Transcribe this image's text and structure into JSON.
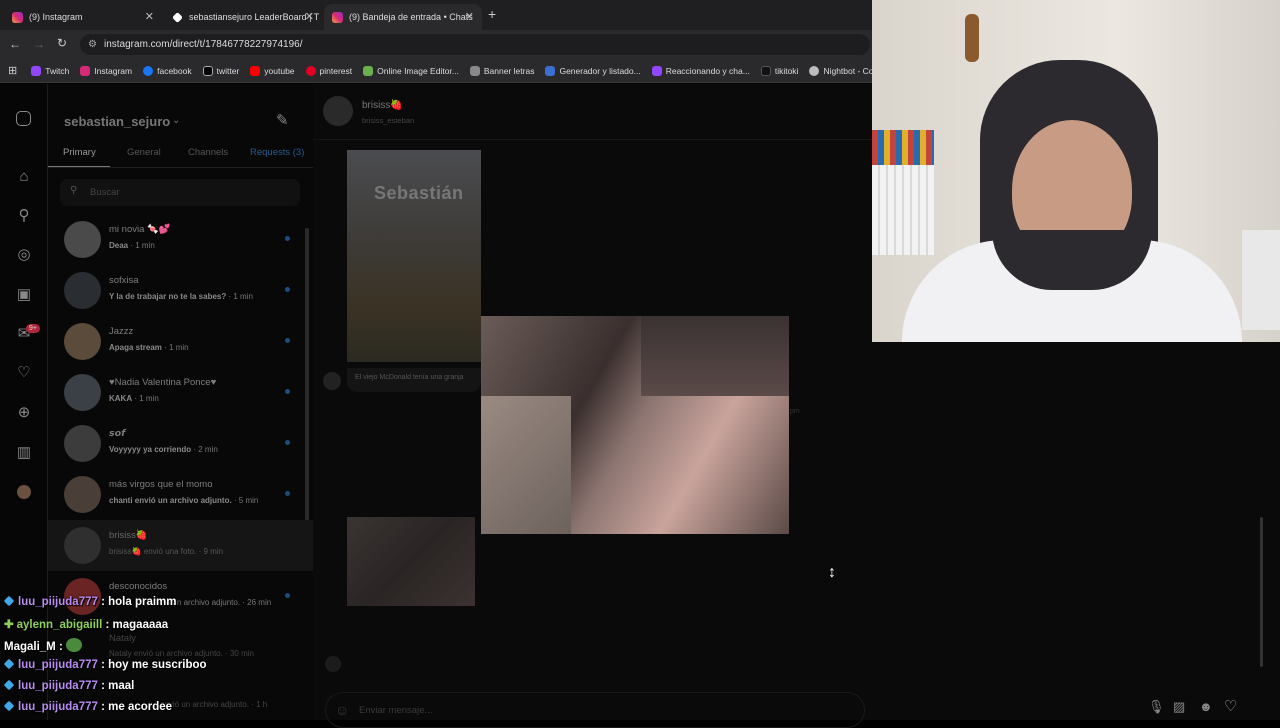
{
  "browser": {
    "tabs": [
      {
        "label": "(9) Instagram"
      },
      {
        "label": "sebastiansejuro LeaderBoard | T"
      },
      {
        "label": "(9) Bandeja de entrada • Chats"
      }
    ],
    "new_tab": "+",
    "url": "instagram.com/direct/t/17846778227974196/",
    "bookmarks": [
      "Twitch",
      "Instagram",
      "facebook",
      "twitter",
      "youtube",
      "pinterest",
      "Online Image Editor...",
      "Banner letras",
      "Generador y listado...",
      "Reaccionando y cha...",
      "tikitoki",
      "Nightbot - Comm"
    ]
  },
  "inbox": {
    "username": "sebastian_sejuro",
    "tabs": {
      "primary": "Primary",
      "general": "General",
      "channels": "Channels",
      "requests": "Requests (3)"
    },
    "search_placeholder": "Buscar",
    "notif_badge": "9+",
    "threads": [
      {
        "name": "mi novia 🍬💕",
        "preview": "Deaa",
        "time": "· 1 min"
      },
      {
        "name": "sofxisa",
        "preview": "Y la de trabajar no te la sabes?",
        "time": "· 1 min"
      },
      {
        "name": "Jazzz",
        "preview": "Apaga stream",
        "time": "· 1 min"
      },
      {
        "name": "♥Nadia Valentina Ponce♥",
        "preview": "KAKA",
        "time": "· 1 min"
      },
      {
        "name": "𝙨𝙤𝙛",
        "preview": "Voyyyyy ya corriendo",
        "time": "· 2 min"
      },
      {
        "name": "más virgos que el momo",
        "preview": "chanti envió un archivo adjunto.",
        "time": "· 5 min"
      },
      {
        "name": "brisiss🍓",
        "preview": "brisiss🍓 envió una foto.",
        "time": "· 9 min"
      },
      {
        "name": "desconocidos",
        "preview": "vió un archivo adjunto.",
        "time": "· 26 min"
      },
      {
        "name": "Nataly",
        "preview": "Nataly envió un archivo adjunto.",
        "time": "· 30 min"
      },
      {
        "name": "",
        "preview": "envió un archivo adjunto.",
        "time": "· 1 h"
      }
    ]
  },
  "conversation": {
    "name": "brisiss🍓",
    "handle": "brisiss_esteban",
    "image_caption_overlay": "Sebastián",
    "message_text": "El viejo McDonald tenía una granja",
    "time_fragment": "pm",
    "composer_placeholder": "Enviar mensaje..."
  },
  "chat_overlay": [
    {
      "user": "luu_piijuda777",
      "message": "hola praimm"
    },
    {
      "user": "aylenn_abigaiill",
      "message": "magaaaaa"
    },
    {
      "user": "Magali_M",
      "message": ""
    },
    {
      "user": "luu_piijuda777",
      "message": "hoy me suscriboo"
    },
    {
      "user": "luu_piijuda777",
      "message": "maal"
    },
    {
      "user": "luu_piijuda777",
      "message": "me acordee"
    }
  ],
  "chat_separator": " : "
}
